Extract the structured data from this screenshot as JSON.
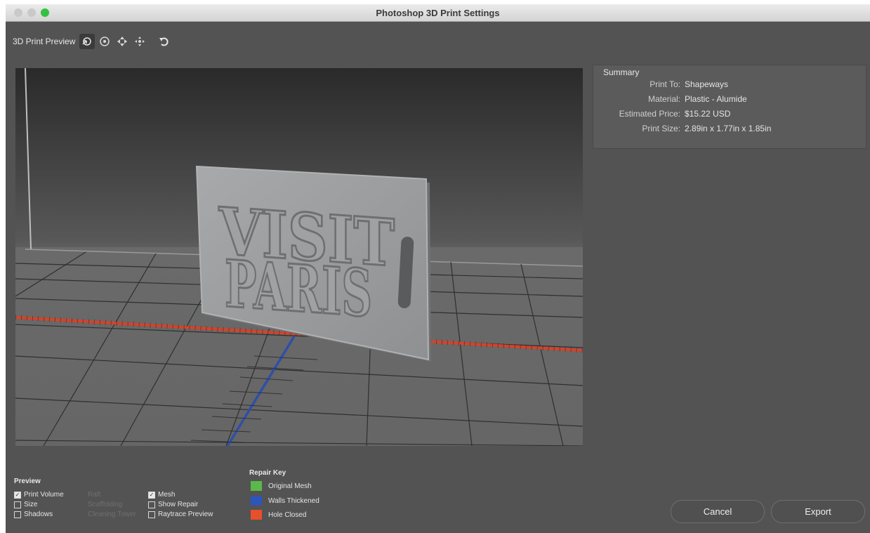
{
  "window": {
    "title": "Photoshop 3D Print Settings"
  },
  "toolbar": {
    "label": "3D Print Preview",
    "tools": [
      "orbit-3d-icon",
      "roll-3d-icon",
      "pan-3d-icon",
      "slide-3d-icon",
      "reset-view-icon"
    ]
  },
  "viewport": {
    "model_text_line1": "VISIT",
    "model_text_line2": "PARIS",
    "axis_colors": {
      "x": "#d4432a",
      "z": "#2f4fa8"
    },
    "model_color": "#9a9c9e"
  },
  "summary": {
    "title": "Summary",
    "rows": [
      {
        "label": "Print To:",
        "value": "Shapeways"
      },
      {
        "label": "Material:",
        "value": "Plastic - Alumide"
      },
      {
        "label": "Estimated Price:",
        "value": "$15.22 USD"
      },
      {
        "label": "Print Size:",
        "value": "2.89in x 1.77in x 1.85in"
      }
    ]
  },
  "preview": {
    "title": "Preview",
    "options": [
      {
        "label": "Print Volume",
        "checked": true,
        "enabled": true
      },
      {
        "label": "Size",
        "checked": false,
        "enabled": true
      },
      {
        "label": "Shadows",
        "checked": false,
        "enabled": true
      },
      {
        "label": "Raft",
        "checked": false,
        "enabled": false
      },
      {
        "label": "Scaffolding",
        "checked": false,
        "enabled": false
      },
      {
        "label": "Cleaning Tower",
        "checked": false,
        "enabled": false
      },
      {
        "label": "Mesh",
        "checked": true,
        "enabled": true
      },
      {
        "label": "Show Repair",
        "checked": false,
        "enabled": true
      },
      {
        "label": "Raytrace Preview",
        "checked": false,
        "enabled": true
      }
    ]
  },
  "repair_key": {
    "title": "Repair Key",
    "items": [
      {
        "label": "Original Mesh",
        "color": "#5bb84a"
      },
      {
        "label": "Walls Thickened",
        "color": "#2f55b8"
      },
      {
        "label": "Hole Closed",
        "color": "#e8502c"
      }
    ]
  },
  "buttons": {
    "cancel": "Cancel",
    "export": "Export"
  }
}
